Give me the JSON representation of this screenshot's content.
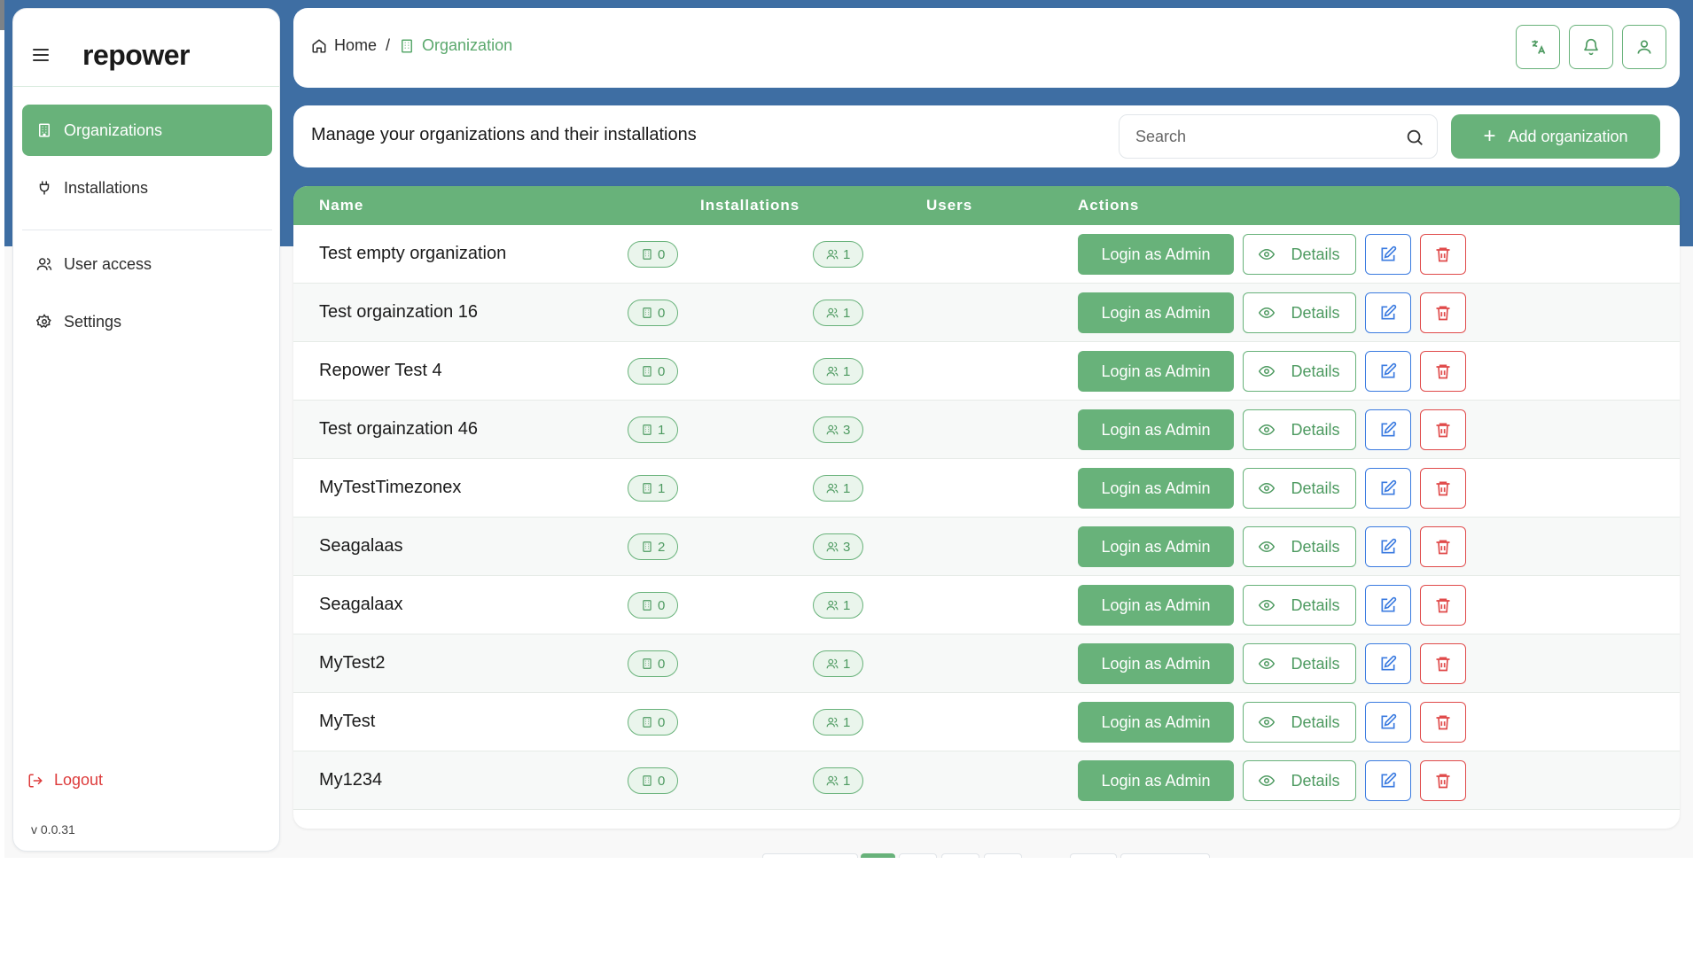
{
  "brand": {
    "logo_text": "repower"
  },
  "sidebar": {
    "items": [
      {
        "label": "Organizations",
        "icon": "building-icon",
        "active": true
      },
      {
        "label": "Installations",
        "icon": "plug-icon",
        "active": false
      },
      {
        "label": "User access",
        "icon": "users-icon",
        "active": false
      },
      {
        "label": "Settings",
        "icon": "gear-icon",
        "active": false
      }
    ],
    "logout_label": "Logout",
    "version": "v 0.0.31"
  },
  "breadcrumb": {
    "home": "Home",
    "separator": "/",
    "current": "Organization"
  },
  "header": {
    "title": "Manage your organizations and their installations",
    "search_placeholder": "Search",
    "add_button": "Add organization"
  },
  "table": {
    "columns": [
      "Name",
      "Installations",
      "Users",
      "Actions"
    ],
    "login_label": "Login as Admin",
    "details_label": "Details",
    "rows": [
      {
        "name": "Test empty organization",
        "installations": "0",
        "users": "1"
      },
      {
        "name": "Test orgainzation 16",
        "installations": "0",
        "users": "1"
      },
      {
        "name": "Repower Test 4",
        "installations": "0",
        "users": "1"
      },
      {
        "name": "Test orgainzation 46",
        "installations": "1",
        "users": "3"
      },
      {
        "name": "MyTestTimezonex",
        "installations": "1",
        "users": "1"
      },
      {
        "name": "Seagalaas",
        "installations": "2",
        "users": "3"
      },
      {
        "name": "Seagalaax",
        "installations": "0",
        "users": "1"
      },
      {
        "name": "MyTest2",
        "installations": "0",
        "users": "1"
      },
      {
        "name": "MyTest",
        "installations": "0",
        "users": "1"
      },
      {
        "name": "My1234",
        "installations": "0",
        "users": "1"
      }
    ]
  },
  "colors": {
    "accent": "#68b27a",
    "edit": "#3b7be0",
    "delete": "#e04a4a",
    "header_bg": "#3e6ea3"
  }
}
